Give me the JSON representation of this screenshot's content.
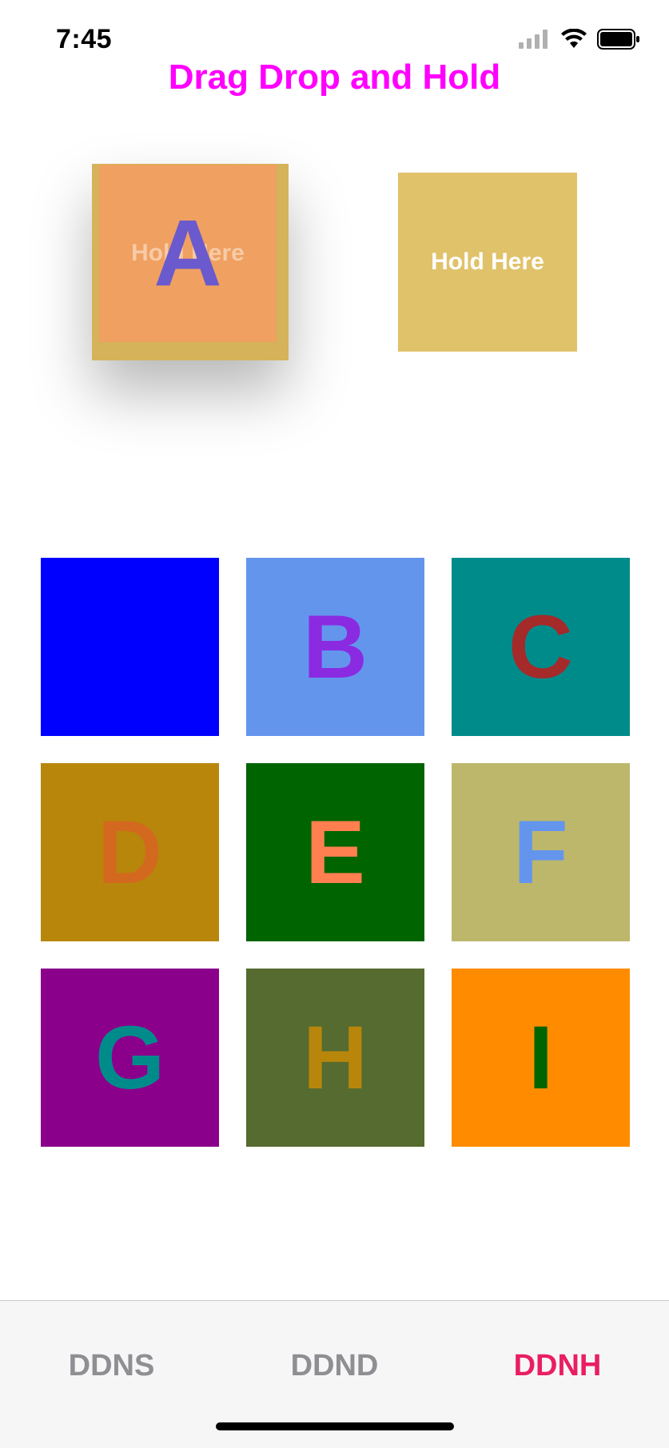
{
  "status_bar": {
    "time": "7:45"
  },
  "header": {
    "title": "Drag Drop and Hold",
    "title_color": "#ff00ff"
  },
  "drop_zones": [
    {
      "label": "Hold Here",
      "color": "#d4b35a"
    },
    {
      "label": "Hold Here",
      "color": "#e0c26a"
    }
  ],
  "dragging_tile": {
    "letter": "A",
    "background": "#f0a060",
    "letter_color": "#6a5acd"
  },
  "grid_tiles": [
    {
      "letter": "",
      "background": "#0000ff",
      "letter_color": "#0000ff"
    },
    {
      "letter": "B",
      "background": "#6495ed",
      "letter_color": "#8a2be2"
    },
    {
      "letter": "C",
      "background": "#008b8b",
      "letter_color": "#a52a2a"
    },
    {
      "letter": "D",
      "background": "#b8860b",
      "letter_color": "#d2691e"
    },
    {
      "letter": "E",
      "background": "#006400",
      "letter_color": "#ff7f50"
    },
    {
      "letter": "F",
      "background": "#bdb76b",
      "letter_color": "#6495ed"
    },
    {
      "letter": "G",
      "background": "#8b008b",
      "letter_color": "#008b8b"
    },
    {
      "letter": "H",
      "background": "#556b2f",
      "letter_color": "#b8860b"
    },
    {
      "letter": "I",
      "background": "#ff8c00",
      "letter_color": "#006400"
    }
  ],
  "tab_bar": {
    "tabs": [
      {
        "label": "DDNS",
        "active": false
      },
      {
        "label": "DDND",
        "active": false
      },
      {
        "label": "DDNH",
        "active": true
      }
    ],
    "active_color": "#e91e63",
    "inactive_color": "#8e8e93"
  }
}
